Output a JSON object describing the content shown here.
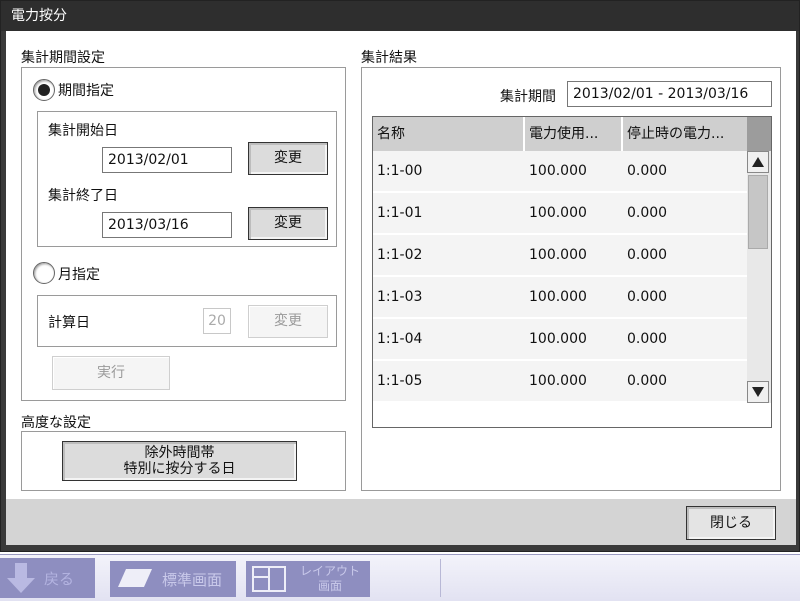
{
  "window": {
    "title": "電力按分"
  },
  "period_settings": {
    "section_label": "集計期間設定",
    "period_option": {
      "label": "期間指定",
      "checked": true
    },
    "start": {
      "label": "集計開始日",
      "value": "2013/02/01",
      "change_label": "変更"
    },
    "end": {
      "label": "集計終了日",
      "value": "2013/03/16",
      "change_label": "変更"
    },
    "month_option": {
      "label": "月指定",
      "checked": false
    },
    "calc_day": {
      "label": "計算日",
      "value": "20",
      "change_label": "変更"
    },
    "execute_label": "実行"
  },
  "advanced": {
    "section_label": "高度な設定",
    "button_line1": "除外時間帯",
    "button_line2": "特別に按分する日"
  },
  "results": {
    "section_label": "集計結果",
    "period_label": "集計期間",
    "period_value": "2013/02/01 - 2013/03/16",
    "columns": [
      "名称",
      "電力使用...",
      "停止時の電力..."
    ],
    "rows": [
      [
        "1:1-00",
        "100.000",
        "0.000"
      ],
      [
        "1:1-01",
        "100.000",
        "0.000"
      ],
      [
        "1:1-02",
        "100.000",
        "0.000"
      ],
      [
        "1:1-03",
        "100.000",
        "0.000"
      ],
      [
        "1:1-04",
        "100.000",
        "0.000"
      ],
      [
        "1:1-05",
        "100.000",
        "0.000"
      ]
    ]
  },
  "footer": {
    "close_label": "閉じる"
  },
  "taskbar": {
    "back_label": "戻る",
    "standard_label": "標準画面",
    "layout_line1": "レイアウト",
    "layout_line2": "画面"
  }
}
